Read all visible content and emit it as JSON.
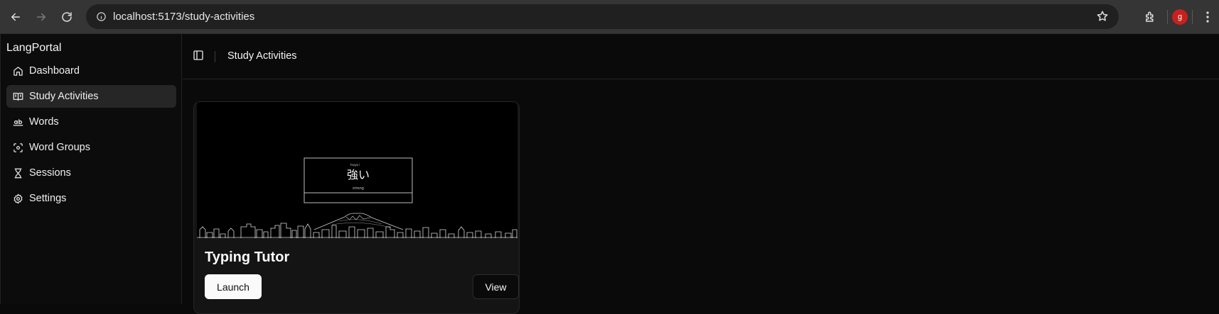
{
  "browser": {
    "url": "localhost:5173/study-activities",
    "profile_initial": "g"
  },
  "sidebar": {
    "brand": "LangPortal",
    "items": [
      {
        "label": "Dashboard",
        "icon": "home-icon"
      },
      {
        "label": "Study Activities",
        "icon": "book-open-icon",
        "active": true
      },
      {
        "label": "Words",
        "icon": "whole-word-icon"
      },
      {
        "label": "Word Groups",
        "icon": "scan-icon"
      },
      {
        "label": "Sessions",
        "icon": "hourglass-icon"
      },
      {
        "label": "Settings",
        "icon": "gear-icon"
      }
    ]
  },
  "header": {
    "title": "Study Activities"
  },
  "activities": [
    {
      "title": "Typing Tutor",
      "thumbnail": {
        "reading": "tsuyo i",
        "word": "強い",
        "meaning": "strong"
      },
      "launch_label": "Launch",
      "view_label": "View"
    }
  ],
  "colors": {
    "accent_avatar": "#c5221f",
    "active_item_bg": "#262626",
    "launch_bg": "#fafafa"
  }
}
